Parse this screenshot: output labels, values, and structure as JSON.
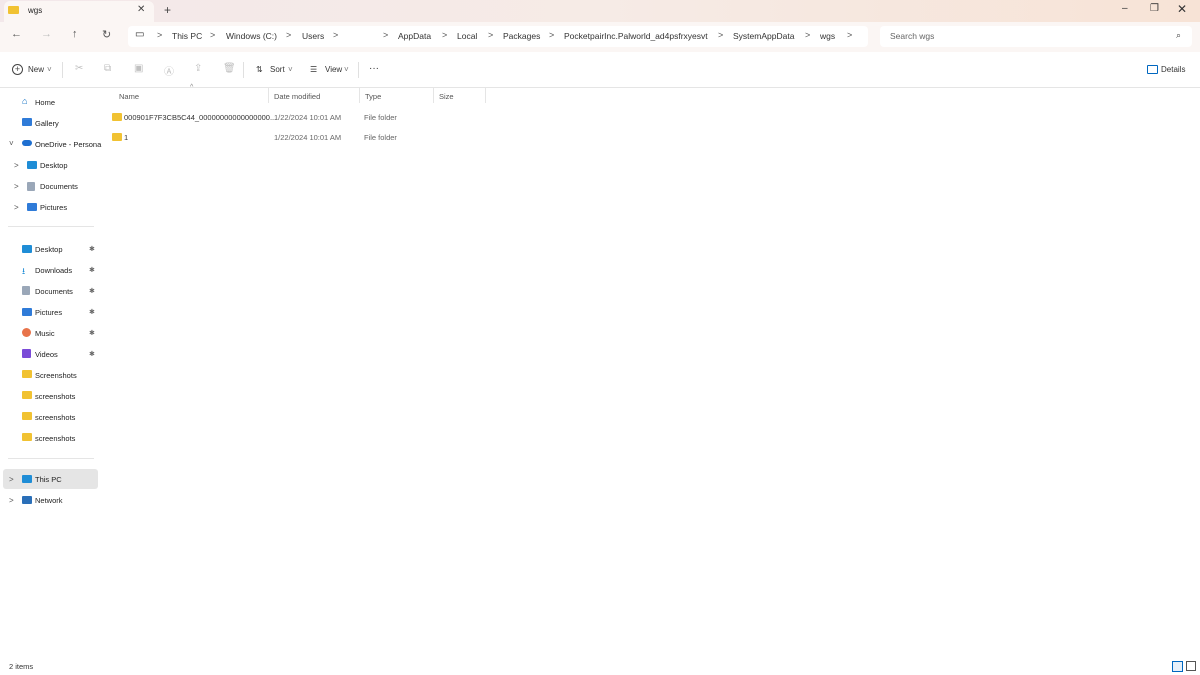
{
  "window": {
    "tab_title": "wgs",
    "tab_close": "✕",
    "new_tab": "+",
    "minimize": "–",
    "maximize": "❐",
    "close": "✕"
  },
  "nav": {
    "back": "←",
    "forward": "→",
    "up": "↑",
    "refresh": "↻",
    "display": "▭"
  },
  "breadcrumb": {
    "sep": ">",
    "items": [
      "This PC",
      "Windows (C:)",
      "Users",
      "AppData",
      "Local",
      "Packages",
      "PocketpairInc.Palworld_ad4psfrxyesvt",
      "SystemAppData",
      "wgs"
    ]
  },
  "search": {
    "placeholder": "Search wgs",
    "icon": "⌕"
  },
  "toolbar": {
    "new_label": "New",
    "sort_label": "Sort",
    "view_label": "View",
    "more_label": "···",
    "details_label": "Details",
    "caret": "˅"
  },
  "sidebar": {
    "home": "Home",
    "gallery": "Gallery",
    "onedrive": "OneDrive - Persona",
    "od_desktop": "Desktop",
    "od_documents": "Documents",
    "od_pictures": "Pictures",
    "quick": [
      {
        "label": "Desktop",
        "pinned": true
      },
      {
        "label": "Downloads",
        "pinned": true
      },
      {
        "label": "Documents",
        "pinned": true
      },
      {
        "label": "Pictures",
        "pinned": true
      },
      {
        "label": "Music",
        "pinned": true
      },
      {
        "label": "Videos",
        "pinned": true
      },
      {
        "label": "Screenshots",
        "pinned": false
      },
      {
        "label": "screenshots",
        "pinned": false
      },
      {
        "label": "screenshots",
        "pinned": false
      },
      {
        "label": "screenshots",
        "pinned": false
      }
    ],
    "this_pc": "This PC",
    "network": "Network",
    "pin_glyph": "✱",
    "chevron": ">",
    "chevron_open": "˅"
  },
  "table": {
    "columns": [
      "Name",
      "Date modified",
      "Type",
      "Size"
    ],
    "sort_indicator": "^",
    "rows": [
      {
        "name": "000901F7F3CB5C44_00000000000000000...",
        "date": "1/22/2024 10:01 AM",
        "type": "File folder",
        "size": ""
      },
      {
        "name": "1",
        "date": "1/22/2024 10:01 AM",
        "type": "File folder",
        "size": ""
      }
    ]
  },
  "status": {
    "item_count": "2 items"
  },
  "colors": {
    "accent": "#0067c0",
    "folder": "#f1c232",
    "selection": "#e5e5e5",
    "titlebar_start": "#f3e8ea",
    "titlebar_end": "#f7e3d6"
  }
}
